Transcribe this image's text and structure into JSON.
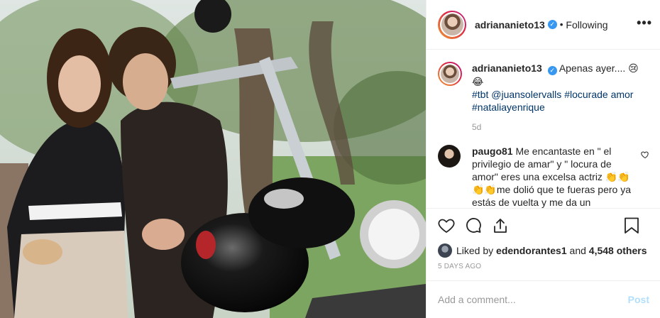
{
  "header": {
    "username": "adriananieto13",
    "verified_mark": "✓",
    "separator": "•",
    "follow_status": "Following",
    "more_label": "•••"
  },
  "caption": {
    "username": "adriananieto13",
    "text": "Apenas ayer.... 😢😂",
    "hashtags": [
      "#tbt",
      "@juansolervalls",
      "#locurade amor",
      "#nataliayenrique"
    ],
    "time": "5d"
  },
  "comment": {
    "username": "paugo81",
    "text": "Me encantaste en \" el privilegio de amar\" y \" locura de amor\" eres una excelsa actriz 👏👏👏👏me dolió que te fueras pero ya estás de vuelta y me da un"
  },
  "likes": {
    "prefix": "Liked by",
    "user": "edendorantes1",
    "joiner": "and",
    "count": "4,548 others"
  },
  "posted_ago": "5 DAYS AGO",
  "add_comment": {
    "placeholder": "Add a comment...",
    "post_label": "Post"
  },
  "icons": {
    "like": "heart-icon",
    "comment": "comment-icon",
    "share": "share-icon",
    "save": "bookmark-icon",
    "more": "more-options-icon"
  },
  "colors": {
    "link": "#003569",
    "verified": "#3897f0",
    "muted": "#999999",
    "post_disabled": "#b2dffc"
  }
}
